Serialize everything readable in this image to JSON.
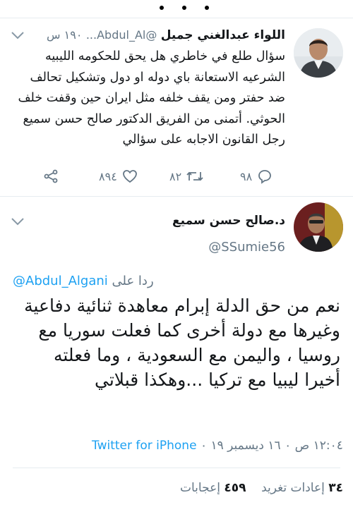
{
  "parent_tweet": {
    "name": "اللواء عبدالغني جميل",
    "handle": "@Abdul_Al...",
    "time": "١٩٠ س",
    "text": "سؤال طلع في خاطري هل يحق للحكومه الليبيه الشرعيه الاستعانة باي دوله او دول وتشكيل تحالف ضد حفتر ومن يقف خلفه مثل ايران حين وقفت خلف الحوثي. أتمنى من الفريق الدكتور صالح حسن سميع رجل القانون الاجابه على سؤالي",
    "actions": {
      "replies": "٩٨",
      "retweets": "٨٢",
      "likes": "٨٩٤"
    }
  },
  "main_tweet": {
    "name": "د.صالح حسن سميع",
    "handle": "@SSumie56",
    "reply_prefix": "ردا على",
    "reply_to": "@Abdul_Algani",
    "text": "نعم من حق الدلة إبرام معاهدة ثنائية دفاعية وغيرها مع دولة أخرى كما فعلت سوريا مع روسيا ، واليمن مع السعودية ، وما فعلته أخيرا ليبيا مع تركيا ...وهكذا قبلاتي",
    "timestamp": "١٢:٠٤ ص ٠ ١٦ ديسمبر ١٩ ٠",
    "source": "Twitter for iPhone",
    "stats": {
      "retweets_count": "٣٤",
      "retweets_label": "إعادات تغريد",
      "likes_count": "٤٥٩",
      "likes_label": "إعجابات"
    }
  },
  "colors": {
    "link": "#1da1f2",
    "secondary_text": "#657786",
    "primary_text": "#14171a",
    "divider": "#e6ecf0"
  }
}
